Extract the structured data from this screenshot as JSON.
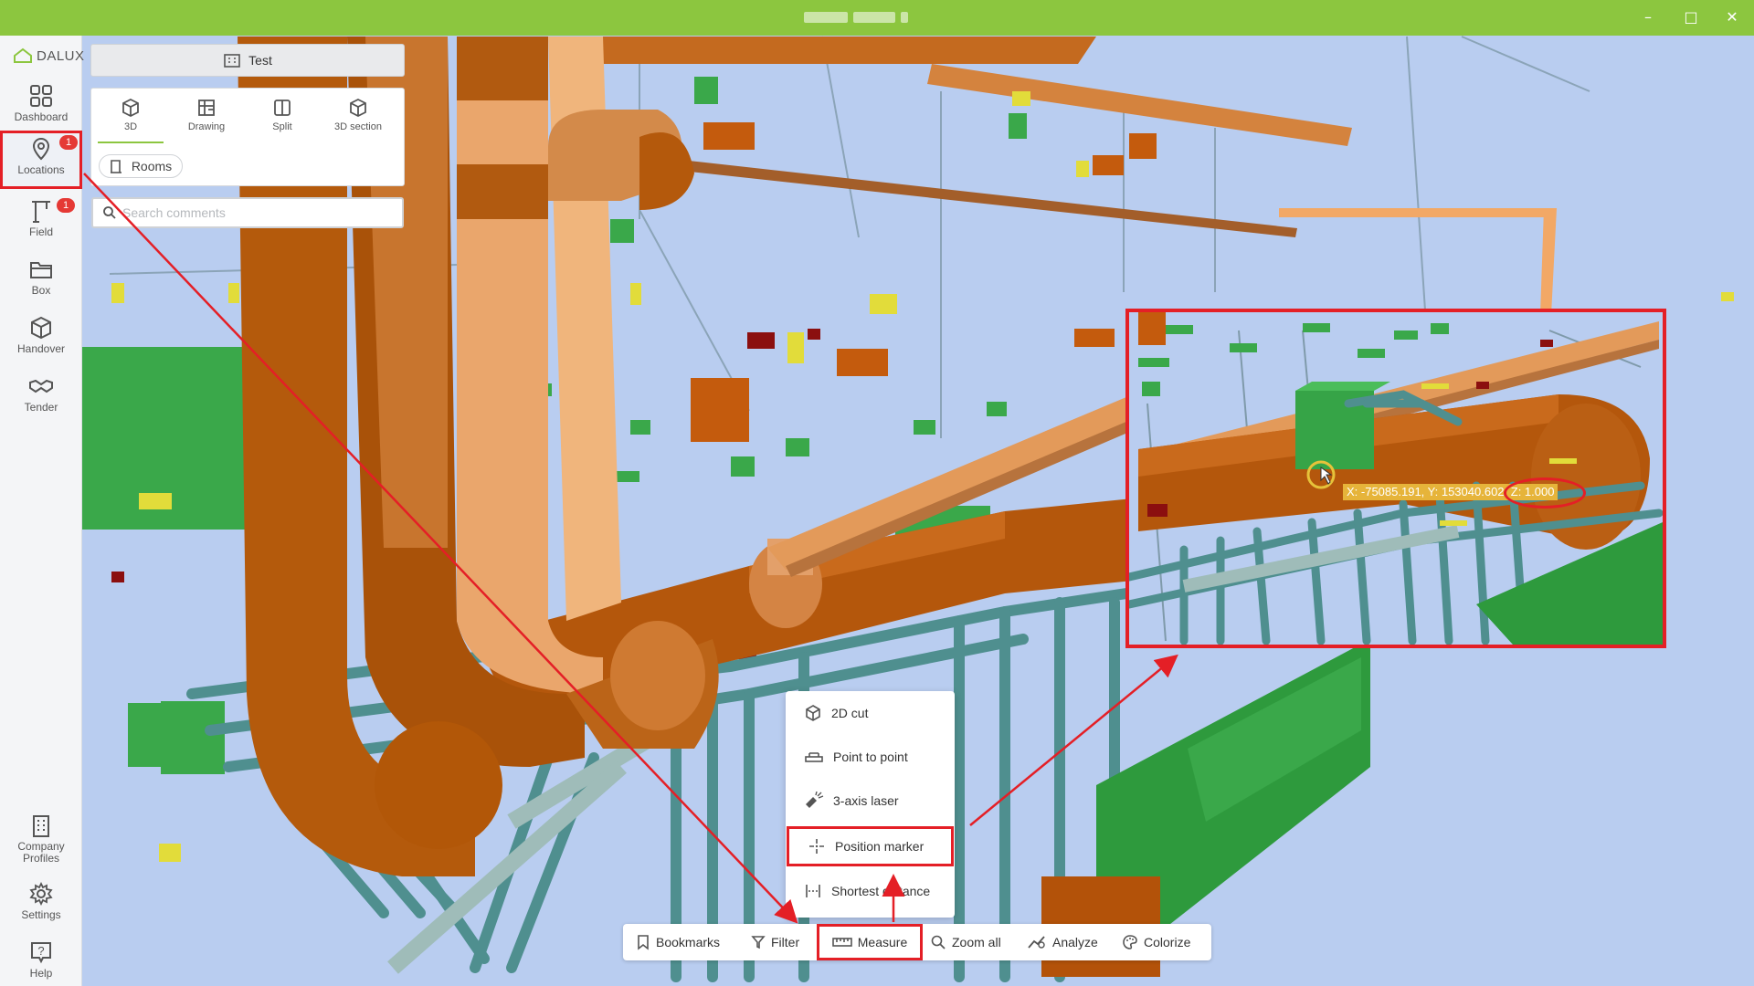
{
  "window": {
    "title": "Dalux",
    "controls": [
      "minimize",
      "maximize",
      "close"
    ]
  },
  "logo": {
    "text": "DALUX"
  },
  "sidebar": {
    "items": [
      {
        "label": "Dashboard",
        "icon": "grid-icon"
      },
      {
        "label": "Locations",
        "icon": "location-pin-icon",
        "badge": "1",
        "active": true
      },
      {
        "label": "Field",
        "icon": "crane-icon",
        "badge": "1"
      },
      {
        "label": "Box",
        "icon": "folder-icon"
      },
      {
        "label": "Handover",
        "icon": "cube-icon"
      },
      {
        "label": "Tender",
        "icon": "handshake-icon"
      }
    ],
    "bottom_items": [
      {
        "label_line1": "Company",
        "label_line2": "Profiles",
        "icon": "building-icon"
      },
      {
        "label": "Settings",
        "icon": "gear-icon"
      },
      {
        "label": "Help",
        "icon": "help-icon"
      }
    ]
  },
  "panel": {
    "title": "Test",
    "view_tabs": [
      {
        "label": "3D",
        "icon": "cube-icon",
        "active": true
      },
      {
        "label": "Drawing",
        "icon": "drawing-icon"
      },
      {
        "label": "Split",
        "icon": "split-icon"
      },
      {
        "label": "3D section",
        "icon": "section-cube-icon"
      }
    ],
    "rooms_label": "Rooms",
    "search_placeholder": "Search comments"
  },
  "measure_menu": {
    "items": [
      {
        "label": "2D cut",
        "icon": "cube-cut-icon"
      },
      {
        "label": "Point to point",
        "icon": "ruler-icon"
      },
      {
        "label": "3-axis laser",
        "icon": "laser-icon"
      },
      {
        "label": "Position marker",
        "icon": "crosshair-icon",
        "highlighted": true
      },
      {
        "label": "Shortest distance",
        "icon": "distance-icon"
      }
    ]
  },
  "toolbar": {
    "bookmarks": "Bookmarks",
    "filter": "Filter",
    "measure": "Measure",
    "zoom_all": "Zoom all",
    "analyze": "Analyze",
    "colorize": "Colorize"
  },
  "inset": {
    "coordinate": "X: -75085.191, Y: 153040.602, Z: 1.000"
  },
  "colors": {
    "brand": "#8cc63f",
    "highlight": "#e41f26",
    "pipe_orange": "#b95a0d",
    "pipe_light": "#e8a46a",
    "pipe_teal": "#5e9e9c",
    "box_green": "#3aa84a",
    "sky": "#b9cdf0"
  }
}
